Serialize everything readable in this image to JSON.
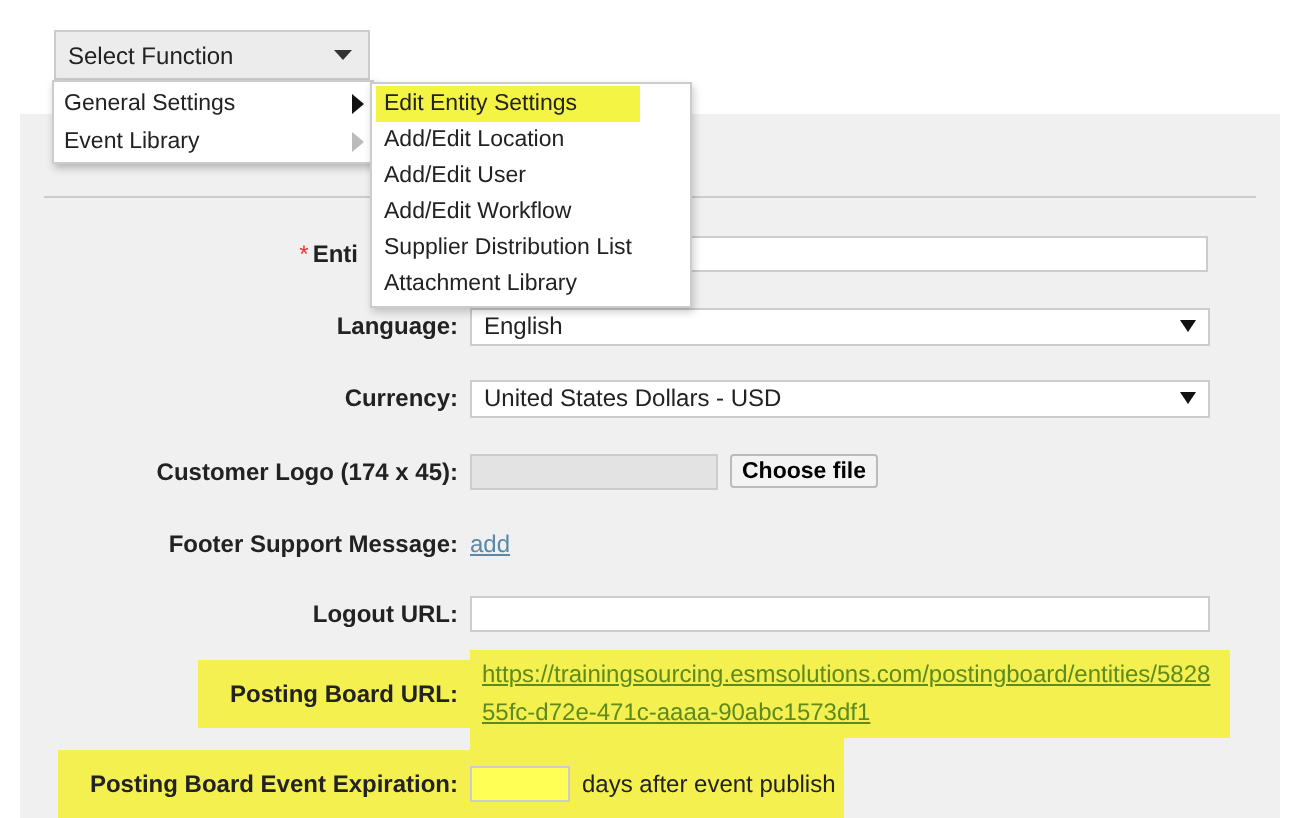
{
  "function_select": {
    "label": "Select Function"
  },
  "menu": {
    "items": [
      {
        "label": "General Settings",
        "expanded": true
      },
      {
        "label": "Event Library",
        "expanded": false
      }
    ]
  },
  "submenu": {
    "items": [
      {
        "label": "Edit Entity Settings",
        "selected": true
      },
      {
        "label": "Add/Edit Location",
        "selected": false
      },
      {
        "label": "Add/Edit User",
        "selected": false
      },
      {
        "label": "Add/Edit Workflow",
        "selected": false
      },
      {
        "label": "Supplier Distribution List",
        "selected": false
      },
      {
        "label": "Attachment Library",
        "selected": false
      }
    ]
  },
  "form": {
    "rows": [
      {
        "kind": "covered_text",
        "required_mark": "*",
        "label": "Enti",
        "highlighted": false
      },
      {
        "kind": "select",
        "label": "Language:",
        "value": "English",
        "highlighted": false
      },
      {
        "kind": "select",
        "label": "Currency:",
        "value": "United States Dollars - USD",
        "highlighted": false
      },
      {
        "kind": "file",
        "label": "Customer Logo (174 x 45):",
        "button": "Choose file",
        "highlighted": false
      },
      {
        "kind": "link",
        "label": "Footer Support Message:",
        "link": "add",
        "highlighted": false
      },
      {
        "kind": "text",
        "label": "Logout URL:",
        "highlighted": false
      },
      {
        "kind": "url",
        "label": "Posting Board URL:",
        "url": "https://trainingsourcing.esmsolutions.com/postingboard/entities/582855fc-d72e-471c-aaaa-90abc1573df1",
        "highlighted": true
      },
      {
        "kind": "number",
        "label": "Posting Board Event Expiration:",
        "suffix": "days after event publish",
        "highlighted": true
      }
    ]
  }
}
